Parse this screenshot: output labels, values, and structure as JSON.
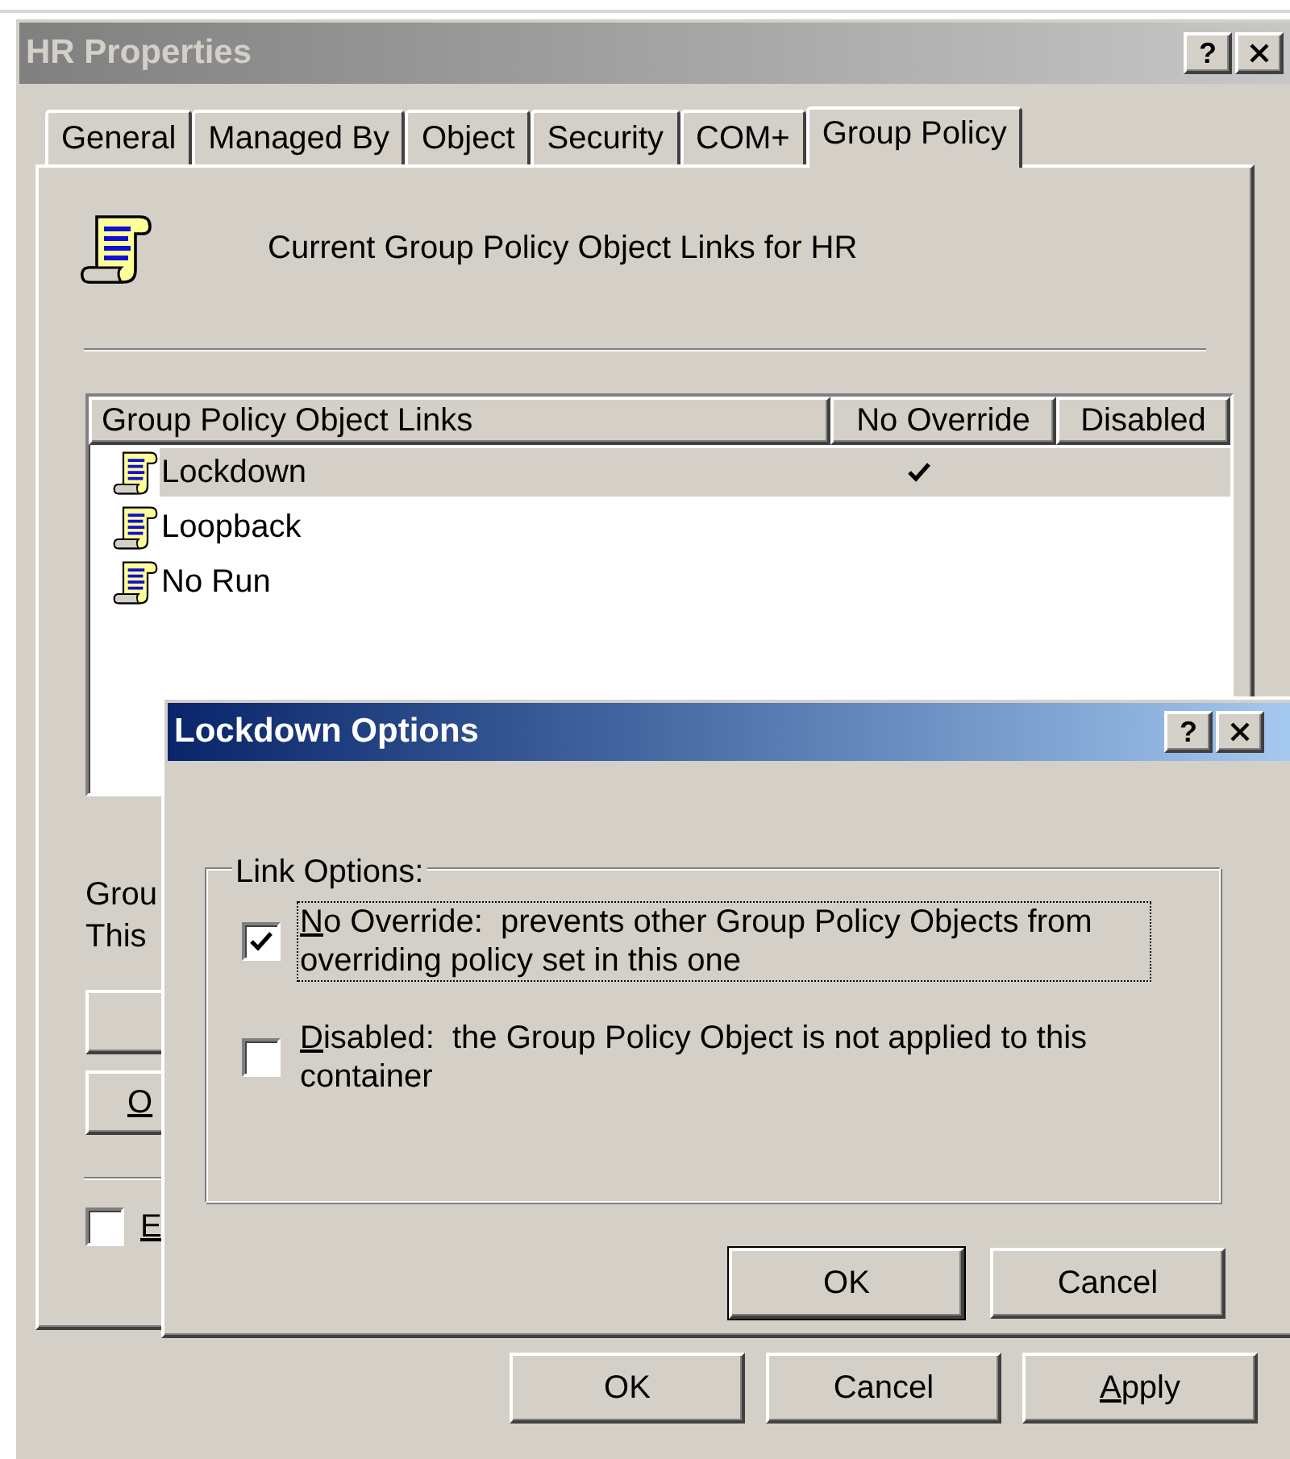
{
  "window": {
    "title": "HR Properties",
    "help_button": "?"
  },
  "tabs": [
    {
      "label": "General",
      "selected": false
    },
    {
      "label": "Managed By",
      "selected": false
    },
    {
      "label": "Object",
      "selected": false
    },
    {
      "label": "Security",
      "selected": false
    },
    {
      "label": "COM+",
      "selected": false
    },
    {
      "label": "Group Policy",
      "selected": true
    }
  ],
  "header": {
    "text": "Current Group Policy Object Links for HR"
  },
  "links_list": {
    "columns": [
      "Group Policy Object Links",
      "No Override",
      "Disabled"
    ],
    "rows": [
      {
        "name": "Lockdown",
        "no_override": true,
        "disabled": false,
        "selected": true
      },
      {
        "name": "Loopback",
        "no_override": false,
        "disabled": false,
        "selected": false
      },
      {
        "name": "No Run",
        "no_override": false,
        "disabled": false,
        "selected": false
      }
    ]
  },
  "partial_texts": [
    "Grou",
    "This"
  ],
  "side_button": {
    "label": "O",
    "underlined": true
  },
  "block_checkbox": {
    "label": "E",
    "checked": false,
    "underlined": true
  },
  "buttons": [
    {
      "label": "OK",
      "underlined": false
    },
    {
      "label": "Cancel",
      "underlined": false
    },
    {
      "label": "Apply",
      "underlined": true
    }
  ],
  "dialog": {
    "title": "Lockdown Options",
    "help_button": "?",
    "group_label": "Link Options:",
    "options": [
      {
        "label": "No Override:  prevents other Group Policy Objects from overriding policy set in this one",
        "checked": true,
        "focused": true,
        "underlined": true
      },
      {
        "label": "Disabled:  the Group Policy Object is not applied to this container",
        "checked": false,
        "focused": false,
        "underlined": true
      }
    ],
    "buttons": [
      {
        "label": "OK",
        "default": true
      },
      {
        "label": "Cancel",
        "default": false
      }
    ]
  }
}
